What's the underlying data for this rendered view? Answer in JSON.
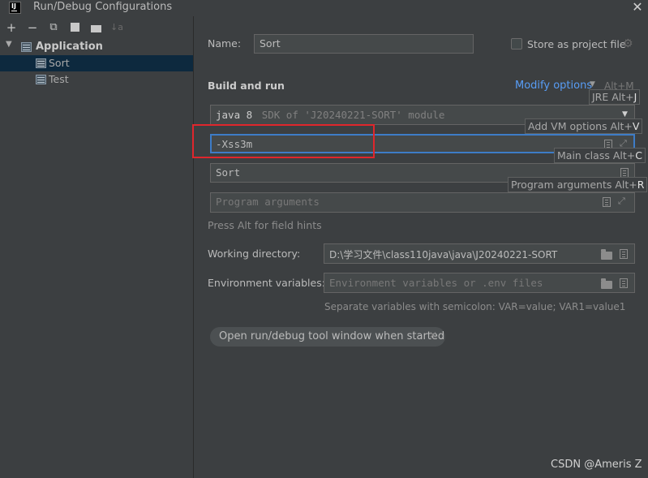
{
  "window": {
    "title": "Run/Debug Configurations",
    "app_logo": "IJ"
  },
  "toolbar": {
    "add": "+",
    "remove": "−",
    "copy": "⧉",
    "save": "🖫",
    "new_folder": "📁",
    "sort": "↓a"
  },
  "tree": {
    "group": "Application",
    "items": [
      {
        "label": "Sort",
        "selected": true
      },
      {
        "label": "Test",
        "selected": false
      }
    ]
  },
  "form": {
    "name_label": "Name:",
    "name_value": "Sort",
    "store_label": "Store as project file",
    "section_title": "Build and run",
    "modify_options": "Modify options",
    "modify_shortcut": "Alt+M",
    "jre_keyword": "java 8",
    "jre_detail": "SDK of 'J20240221-SORT' module",
    "vm_options_value": "-Xss3m",
    "main_class_value": "Sort",
    "program_args_placeholder": "Program arguments",
    "field_hint": "Press Alt for field hints",
    "working_dir_label": "Working directory:",
    "working_dir_value": "D:\\学习文件\\class110java\\java\\J20240221-SORT",
    "env_label": "Environment variables:",
    "env_placeholder": "Environment variables or .env files",
    "env_hint": "Separate variables with semicolon: VAR=value; VAR1=value1",
    "chip_label": "Open run/debug tool window when started"
  },
  "hints": {
    "jre": {
      "text": "JRE Alt+",
      "key": "J"
    },
    "vm": {
      "text": "Add VM options Alt+",
      "key": "V"
    },
    "main": {
      "text": "Main class Alt+",
      "key": "C"
    },
    "args": {
      "text": "Program arguments Alt+",
      "key": "R"
    }
  },
  "watermark": "CSDN @Ameris Z",
  "colors": {
    "accent_link": "#589df6",
    "highlight_box": "#e0262c",
    "focus_border": "#3d7cc7",
    "selection": "#0d293e"
  }
}
